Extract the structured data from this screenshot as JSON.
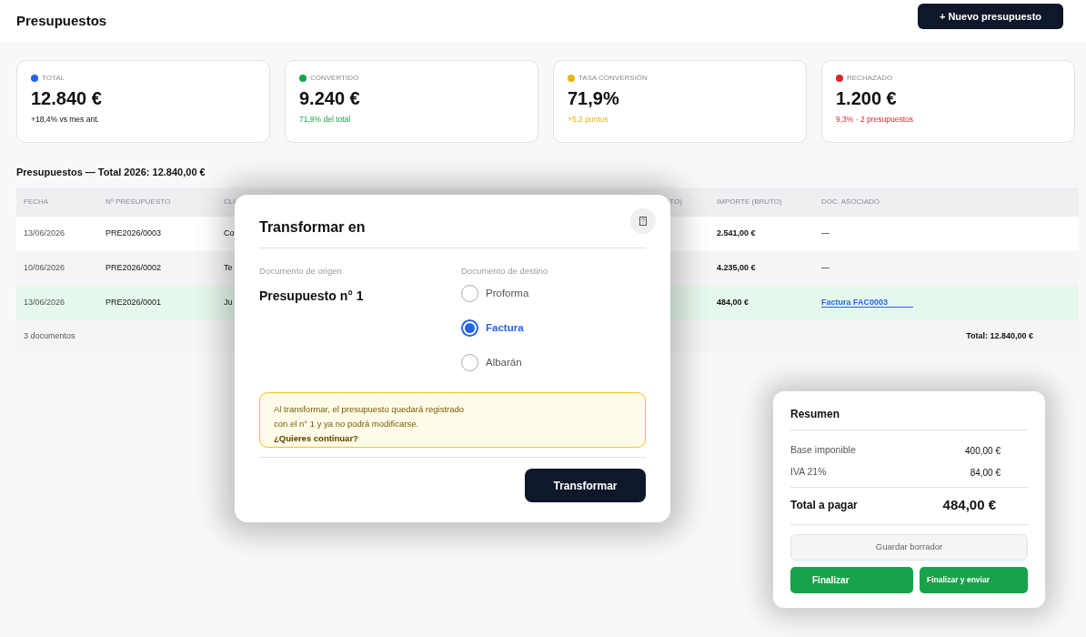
{
  "header": {
    "title": "Presupuestos",
    "new_button": "+ Nuevo presupuesto"
  },
  "stats": [
    {
      "label": "TOTAL",
      "value": "12.840 €",
      "sub": "+18,4% vs mes ant.",
      "kind": "neutral",
      "color": "#2563eb"
    },
    {
      "label": "CONVERTIDO",
      "value": "9.240 €",
      "sub": "71,9% del total",
      "kind": "accent",
      "color": "#16a34a"
    },
    {
      "label": "TASA CONVERSIÓN",
      "value": "71,9%",
      "sub": "+5,2 puntos",
      "kind": "accent",
      "color": "#eab308"
    },
    {
      "label": "RECHAZADO",
      "value": "1.200 €",
      "sub": "9,3% · 2 presupuestos",
      "kind": "accent",
      "color": "#dc2626"
    }
  ],
  "table": {
    "title": "Presupuestos — Total 2026: 12.840,00 €",
    "columns": [
      "FECHA",
      "Nº PRESUPUESTO",
      "CLI",
      "TO)",
      "IMPORTE (BRUTO)",
      "DOC. ASOCIADO"
    ],
    "rows": [
      {
        "date": "13/06/2026",
        "number": "PRE2026/0003",
        "column_3": "Co",
        "amount": "2.541,00 €",
        "doc": {
          "kind": "text",
          "text": "—"
        },
        "selected": false
      },
      {
        "date": "10/06/2026",
        "number": "PRE2026/0002",
        "column_3": "Te",
        "amount": "4.235,00 €",
        "doc": {
          "kind": "text",
          "text": "—"
        },
        "selected": false
      },
      {
        "date": "13/06/2026",
        "number": "PRE2026/0001",
        "column_3": "Ju",
        "amount": "484,00 €",
        "doc": {
          "kind": "link",
          "text": "Factura FAC0003"
        },
        "selected": true
      }
    ],
    "count": "3 documentos",
    "total": "Total: 12.840,00 €"
  },
  "dialog": {
    "title": "Transformar en",
    "origin_label": "Documento de origen",
    "origin_value": "Presupuesto n° 1",
    "destination_label": "Documento de destino",
    "options": [
      {
        "label": "Proforma",
        "selected": false
      },
      {
        "label": "Factura",
        "selected": true
      },
      {
        "label": "Albarán",
        "selected": false
      }
    ],
    "warning": "Al transformar, el presupuesto quedará registrado",
    "warning_2": "con el n° 1 y ya no podrá modificarse.",
    "question": "¿Quieres continuar?",
    "confirm": "Transformar"
  },
  "summary": {
    "title": "Resumen",
    "lines": [
      {
        "label": "Base imponible",
        "value": "400,00 €"
      },
      {
        "label": "IVA 21%",
        "value": "84,00 €"
      }
    ],
    "total_label": "Total a pagar",
    "total_value": "484,00 €",
    "draft": "Guardar borrador",
    "finish": "Finalizar",
    "finish_send": "Finalizar y enviar"
  }
}
